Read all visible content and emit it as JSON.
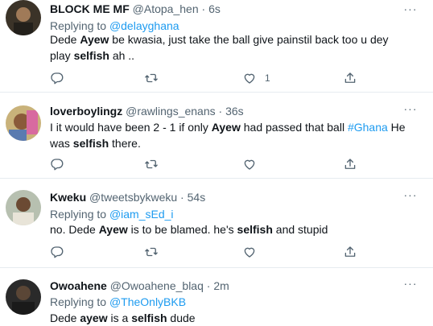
{
  "tweets": [
    {
      "name": "BLOCK ME MF",
      "handle": "@Atopa_hen",
      "time": "6s",
      "replying_prefix": "Replying to ",
      "replying_to": "@delayghana",
      "body": [
        {
          "t": "Dede "
        },
        {
          "t": "Ayew",
          "b": true
        },
        {
          "t": " be kwasia, just take the ball give painstil back too u dey play "
        },
        {
          "t": "selfish",
          "b": true
        },
        {
          "t": " ah .."
        }
      ],
      "likes": "1"
    },
    {
      "name": "loverboylingz",
      "handle": "@rawlings_enans",
      "time": "36s",
      "replying_prefix": "",
      "replying_to": "",
      "body": [
        {
          "t": "I it would have been 2 - 1 if only "
        },
        {
          "t": "Ayew",
          "b": true
        },
        {
          "t": " had passed that ball "
        },
        {
          "t": "#Ghana",
          "h": true
        },
        {
          "t": " He was "
        },
        {
          "t": "selfish",
          "b": true
        },
        {
          "t": " there."
        }
      ],
      "likes": ""
    },
    {
      "name": "Kweku",
      "handle": "@tweetsbykweku",
      "time": "54s",
      "replying_prefix": "Replying to ",
      "replying_to": "@iam_sEd_i",
      "body": [
        {
          "t": "no. Dede "
        },
        {
          "t": "Ayew",
          "b": true
        },
        {
          "t": " is to be blamed. he's "
        },
        {
          "t": "selfish",
          "b": true
        },
        {
          "t": " and stupid"
        }
      ],
      "likes": ""
    },
    {
      "name": "Owoahene",
      "handle": "@Owoahene_blaq",
      "time": "2m",
      "replying_prefix": "Replying to ",
      "replying_to": "@TheOnlyBKB",
      "body": [
        {
          "t": "Dede "
        },
        {
          "t": "ayew",
          "b": true
        },
        {
          "t": " is a "
        },
        {
          "t": "selfish",
          "b": true
        },
        {
          "t": " dude"
        }
      ],
      "likes": ""
    }
  ],
  "labels": {
    "more": "···",
    "dot_separator": " · "
  },
  "colors": {
    "text": "#0f1419",
    "secondary": "#536471",
    "accent": "#1d9bf0",
    "separator": "#e6ecf0"
  },
  "icons": {
    "reply": "reply-icon",
    "retweet": "retweet-icon",
    "like": "heart-icon",
    "share": "share-icon",
    "more": "more-icon"
  }
}
